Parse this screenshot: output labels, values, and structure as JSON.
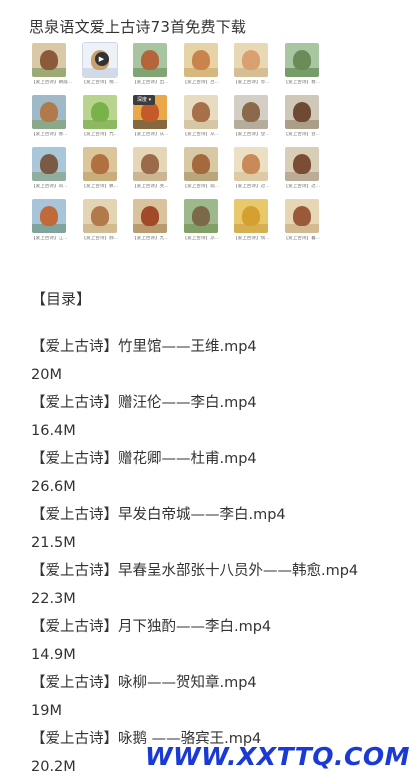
{
  "header": {
    "title": "思泉语文爱上古诗73首免费下载"
  },
  "gallery": {
    "tooltip": "深度 ▾",
    "thumbnails": [
      {
        "caption": "【爱上古诗】朝霞...",
        "bg": "#d9c9a8",
        "fig": "#8a5a3a",
        "ground": "#6b8f4a"
      },
      {
        "caption": "【爱上古诗】赠...",
        "bg": "#eef2f8",
        "fig": "#c9a06e",
        "ground": "#b8c7dc"
      },
      {
        "caption": "【爱上古诗】出...",
        "bg": "#a8c4a0",
        "fig": "#b5653a",
        "ground": "#5e8a4c"
      },
      {
        "caption": "【爱上古诗】吕...",
        "bg": "#e6d3a6",
        "fig": "#c8844c",
        "ground": "#c9a35e"
      },
      {
        "caption": "【爱上古诗】赤...",
        "bg": "#e8d9b5",
        "fig": "#d9a070",
        "ground": "#c4a878"
      },
      {
        "caption": "【爱上古诗】春...",
        "bg": "#a9c6a2",
        "fig": "#6a8d58",
        "ground": "#4d7a3c"
      },
      {
        "caption": "【爱上古诗】春...",
        "bg": "#9fb9c8",
        "fig": "#b07a4a",
        "ground": "#7a9a5a"
      },
      {
        "caption": "【爱上古诗】亢...",
        "bg": "#b9d48e",
        "fig": "#7ab24a",
        "ground": "#6ca03e"
      },
      {
        "caption": "【爱上古诗】从...",
        "bg": "#e9a84a",
        "fig": "#c25a2a",
        "ground": "#333333"
      },
      {
        "caption": "【爱上古诗】从...",
        "bg": "#e8dcc0",
        "fig": "#a8704a",
        "ground": "#c9b48a"
      },
      {
        "caption": "【爱上古诗】登...",
        "bg": "#d4cfc4",
        "fig": "#8a6a4a",
        "ground": "#9a8f7a"
      },
      {
        "caption": "【爱上古诗】登...",
        "bg": "#cfc8b8",
        "fig": "#6e4a34",
        "ground": "#8e7c62"
      },
      {
        "caption": "【爱上古诗】风...",
        "bg": "#a9c7d9",
        "fig": "#7a5a44",
        "ground": "#7a9a6a"
      },
      {
        "caption": "【爱上古诗】枫...",
        "bg": "#dcc59a",
        "fig": "#b07040",
        "ground": "#b89a62"
      },
      {
        "caption": "【爱上古诗】芙...",
        "bg": "#e6d6b8",
        "fig": "#9a6a4a",
        "ground": "#b59a74"
      },
      {
        "caption": "【爱上古诗】观...",
        "bg": "#d8c9a4",
        "fig": "#a46a3e",
        "ground": "#9e8a5a"
      },
      {
        "caption": "【爱上古诗】过...",
        "bg": "#ece0c4",
        "fig": "#c98a5a",
        "ground": "#d4b88a"
      },
      {
        "caption": "【爱上古诗】过...",
        "bg": "#d8cdb6",
        "fig": "#7a4e34",
        "ground": "#a5927a"
      },
      {
        "caption": "【爱上古诗】江...",
        "bg": "#a7c4d8",
        "fig": "#c06a3a",
        "ground": "#5f8a6a"
      },
      {
        "caption": "【爱上古诗】静...",
        "bg": "#e3d4b4",
        "fig": "#b27a4a",
        "ground": "#c4a474"
      },
      {
        "caption": "【爱上古诗】九...",
        "bg": "#d9c39c",
        "fig": "#a04a2a",
        "ground": "#9e7a4a"
      },
      {
        "caption": "【爱上古诗】凉...",
        "bg": "#9db88a",
        "fig": "#7a6a4a",
        "ground": "#6a8a4a"
      },
      {
        "caption": "【爱上古诗】悯...",
        "bg": "#e8c86a",
        "fig": "#d4a030",
        "ground": "#c49a3a"
      },
      {
        "caption": "【爱上古诗】暮...",
        "bg": "#e6d6b4",
        "fig": "#9a5a3a",
        "ground": "#c4a478"
      }
    ]
  },
  "contents": {
    "heading": "【目录】",
    "items": [
      {
        "title": "【爱上古诗】竹里馆——王维.mp4",
        "size": "20M"
      },
      {
        "title": "【爱上古诗】赠汪伦——李白.mp4",
        "size": "16.4M"
      },
      {
        "title": "【爱上古诗】赠花卿——杜甫.mp4",
        "size": "26.6M"
      },
      {
        "title": "【爱上古诗】早发白帝城——李白.mp4",
        "size": "21.5M"
      },
      {
        "title": "【爱上古诗】早春呈水部张十八员外——韩愈.mp4",
        "size": "22.3M"
      },
      {
        "title": "【爱上古诗】月下独酌——李白.mp4",
        "size": "14.9M"
      },
      {
        "title": "【爱上古诗】咏柳——贺知章.mp4",
        "size": "19M"
      },
      {
        "title": "【爱上古诗】咏鹅 ——骆宾王.mp4",
        "size": "20.2M"
      }
    ]
  },
  "watermark": "WWW.XXTTQ.COM"
}
